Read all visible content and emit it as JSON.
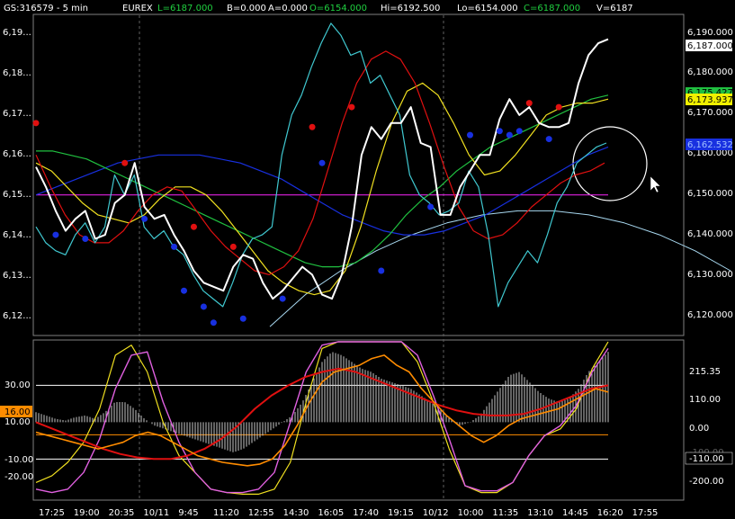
{
  "header": {
    "symbol": "GS:316579 - 5 min",
    "exchange": "EUREX",
    "last": "L=6187.000",
    "bid": "B=0.000",
    "ask": "A=0.000",
    "open": "O=6154.000",
    "high": "Hi=6192.500",
    "low": "Lo=6154.000",
    "close": "C=6187.000",
    "volume": "V=6187"
  },
  "colors": {
    "background": "#000000",
    "price": "#ffffff",
    "cyan": "#40c8d0",
    "red": "#e01010",
    "yellow": "#f0e020",
    "green": "#20c040",
    "blue": "#1830e0",
    "magenta": "#e020e0",
    "lightblue": "#a8d8f0",
    "orange": "#ff8c00",
    "osc_magenta": "#e060e0",
    "histogram": "#c8c8c8"
  },
  "price_axis": {
    "ticks_right": [
      "6,190.000",
      "6,180.000",
      "6,170.000",
      "6,160.000",
      "6,150.000",
      "6,140.000",
      "6,130.000",
      "6,120.000"
    ],
    "ticks_left": [
      "6,19...",
      "6,18...",
      "6,17...",
      "6,16...",
      "6,15...",
      "6,14...",
      "6,13...",
      "6,12..."
    ],
    "current_label": "6,187.000",
    "green_label": "6,175.427",
    "yellow_label": "6,173.937",
    "blue_label": "6,162.532"
  },
  "osc_axis": {
    "ticks_right": [
      "215.35",
      "110.00",
      "0.00",
      "-110.00",
      "-200.00"
    ],
    "ticks_left": [
      "30.00",
      "10.00",
      "-10.00",
      "-20.00"
    ],
    "left_marker": "16.00",
    "partial_label": "-100.00"
  },
  "time_axis": {
    "labels": [
      "17:25",
      "19:00",
      "20:35",
      "10/11",
      "9:45",
      "11:20",
      "12:55",
      "14:30",
      "16:05",
      "17:40",
      "19:15",
      "10/12",
      "10:00",
      "11:35",
      "13:10",
      "14:45",
      "16:20",
      "17:55"
    ]
  },
  "chart_data": [
    {
      "type": "line",
      "panel": "price",
      "ylim": [
        6115,
        6195
      ],
      "levels": {
        "magenta_horizontal": 6150.0
      },
      "series": [
        {
          "key": "price",
          "values": [
            6157,
            6152,
            6146,
            6141,
            6144,
            6146,
            6139,
            6140,
            6148,
            6150,
            6158,
            6147,
            6144,
            6145,
            6140,
            6136,
            6131,
            6128,
            6127,
            6126,
            6132,
            6135,
            6134,
            6128,
            6124,
            6126,
            6129,
            6132,
            6130,
            6125,
            6124,
            6130,
            6142,
            6160,
            6167,
            6164,
            6168,
            6168,
            6172,
            6163,
            6162,
            6145,
            6145,
            6152,
            6156,
            6160,
            6160,
            6169,
            6174,
            6170,
            6172,
            6168,
            6167,
            6167,
            6168,
            6178,
            6185,
            6188,
            6189
          ]
        },
        {
          "key": "cyan",
          "values": [
            6142,
            6138,
            6136,
            6135,
            6140,
            6143,
            6138,
            6142,
            6155,
            6150,
            6155,
            6142,
            6139,
            6141,
            6137,
            6135,
            6130,
            6126,
            6124,
            6122,
            6128,
            6135,
            6139,
            6140,
            6142,
            6160,
            6170,
            6175,
            6182,
            6188,
            6193,
            6190,
            6185,
            6186,
            6178,
            6180,
            6175,
            6170,
            6155,
            6150,
            6148,
            6145,
            6146,
            6148,
            6156,
            6152,
            6140,
            6122,
            6128,
            6132,
            6136,
            6133,
            6140,
            6148,
            6152,
            6158,
            6160,
            6162,
            6163
          ]
        },
        {
          "key": "red",
          "values": [
            6160,
            6152,
            6145,
            6140,
            6138,
            6138,
            6141,
            6146,
            6150,
            6152,
            6151,
            6146,
            6141,
            6137,
            6134,
            6131,
            6130,
            6132,
            6136,
            6144,
            6156,
            6168,
            6178,
            6184,
            6186,
            6184,
            6178,
            6168,
            6157,
            6147,
            6141,
            6139,
            6140,
            6143,
            6147,
            6150,
            6153,
            6155,
            6156,
            6158
          ]
        },
        {
          "key": "yellow",
          "values": [
            6158,
            6156,
            6152,
            6148,
            6145,
            6144,
            6143,
            6145,
            6149,
            6152,
            6152,
            6150,
            6146,
            6141,
            6136,
            6131,
            6128,
            6126,
            6125,
            6126,
            6131,
            6142,
            6156,
            6168,
            6176,
            6178,
            6175,
            6168,
            6160,
            6155,
            6156,
            6160,
            6165,
            6170,
            6172,
            6173,
            6173,
            6174
          ]
        },
        {
          "key": "green",
          "values": [
            6161,
            6161,
            6160,
            6159,
            6157,
            6155,
            6153,
            6151,
            6149,
            6147,
            6145,
            6143,
            6141,
            6139,
            6137,
            6135,
            6133,
            6132,
            6132,
            6133,
            6136,
            6140,
            6145,
            6149,
            6152,
            6156,
            6159,
            6162,
            6164,
            6166,
            6168,
            6170,
            6172,
            6174,
            6175
          ]
        },
        {
          "key": "blue",
          "values": [
            6150,
            6152,
            6154,
            6156,
            6158,
            6159,
            6160,
            6160,
            6160,
            6159,
            6158,
            6156,
            6154,
            6151,
            6148,
            6145,
            6143,
            6141,
            6140,
            6140,
            6141,
            6143,
            6145,
            6148,
            6151,
            6154,
            6157,
            6160,
            6162
          ]
        },
        {
          "key": "lightblue",
          "values": [
            6117,
            6125,
            6131,
            6136,
            6140,
            6143,
            6145,
            6146,
            6146,
            6145,
            6143,
            6140,
            6136,
            6131
          ]
        }
      ],
      "dots_red": [
        [
          0,
          6168
        ],
        [
          9,
          6158
        ],
        [
          16,
          6142
        ],
        [
          20,
          6137
        ],
        [
          28,
          6167
        ],
        [
          32,
          6172
        ],
        [
          50,
          6173
        ],
        [
          53,
          6172
        ]
      ],
      "dots_blue": [
        [
          2,
          6140
        ],
        [
          5,
          6139
        ],
        [
          11,
          6144
        ],
        [
          14,
          6137
        ],
        [
          15,
          6126
        ],
        [
          17,
          6122
        ],
        [
          18,
          6118
        ],
        [
          21,
          6119
        ],
        [
          25,
          6124
        ],
        [
          29,
          6158
        ],
        [
          35,
          6131
        ],
        [
          40,
          6147
        ],
        [
          44,
          6165
        ],
        [
          47,
          6166
        ],
        [
          48,
          6165
        ],
        [
          49,
          6166
        ],
        [
          52,
          6164
        ]
      ]
    },
    {
      "type": "line",
      "panel": "oscillator",
      "ylim": [
        -230,
        240
      ],
      "levels": {
        "upper": 110,
        "zero": 0,
        "lower": -110
      },
      "series": [
        {
          "key": "histogram",
          "values": [
            30,
            20,
            10,
            5,
            15,
            20,
            10,
            30,
            60,
            60,
            40,
            10,
            -10,
            -20,
            -30,
            -40,
            -50,
            -60,
            -70,
            -80,
            -90,
            -80,
            -60,
            -40,
            -20,
            0,
            20,
            60,
            120,
            180,
            210,
            200,
            180,
            160,
            150,
            130,
            120,
            110,
            100,
            80,
            60,
            40,
            10,
            -10,
            0,
            20,
            60,
            100,
            140,
            150,
            120,
            90,
            70,
            60,
            70,
            100,
            150,
            180,
            210
          ]
        },
        {
          "key": "orange",
          "values": [
            -30,
            -40,
            -50,
            -60,
            -70,
            -80,
            -70,
            -60,
            -40,
            -30,
            -40,
            -60,
            -80,
            -100,
            -110,
            -120,
            -125,
            -130,
            -125,
            -110,
            -70,
            -10,
            60,
            120,
            150,
            160,
            170,
            190,
            200,
            170,
            150,
            100,
            60,
            20,
            -10,
            -40,
            -60,
            -40,
            -10,
            10,
            20,
            30,
            40,
            60,
            80,
            100,
            90
          ]
        },
        {
          "key": "red",
          "values": [
            0,
            -20,
            -40,
            -60,
            -80,
            -95,
            -105,
            -110,
            -110,
            -100,
            -80,
            -50,
            -10,
            40,
            80,
            110,
            135,
            150,
            160,
            150,
            130,
            110,
            90,
            70,
            50,
            35,
            25,
            20,
            20,
            25,
            40,
            60,
            80,
            100,
            110
          ]
        },
        {
          "key": "yellow",
          "values": [
            -180,
            -160,
            -120,
            -60,
            40,
            200,
            230,
            150,
            0,
            -100,
            -150,
            -200,
            -210,
            -215,
            -215,
            -200,
            -120,
            60,
            220,
            240,
            240,
            240,
            240,
            240,
            180,
            60,
            -80,
            -190,
            -210,
            -210,
            -180,
            -100,
            -40,
            -20,
            40,
            160,
            240
          ]
        },
        {
          "key": "magenta",
          "values": [
            -200,
            -210,
            -200,
            -150,
            -50,
            100,
            200,
            210,
            60,
            -60,
            -150,
            -200,
            -210,
            -210,
            -200,
            -150,
            0,
            150,
            230,
            240,
            240,
            240,
            240,
            240,
            200,
            80,
            -50,
            -190,
            -205,
            -205,
            -180,
            -100,
            -40,
            -10,
            50,
            150,
            220
          ]
        }
      ]
    }
  ]
}
